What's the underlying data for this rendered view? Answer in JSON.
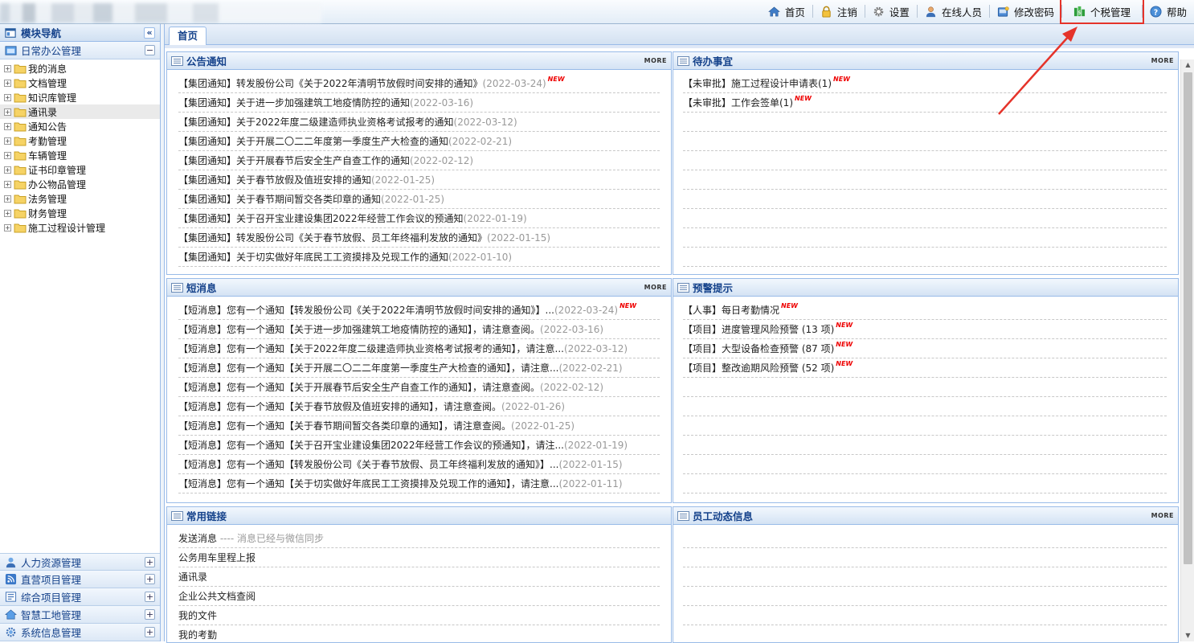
{
  "toolbar": {
    "items": [
      {
        "label": "首页",
        "icon": "home-icon"
      },
      {
        "label": "注销",
        "icon": "lock-icon"
      },
      {
        "label": "设置",
        "icon": "gear-icon"
      },
      {
        "label": "在线人员",
        "icon": "user-icon"
      },
      {
        "label": "修改密码",
        "icon": "password-icon"
      },
      {
        "label": "个税管理",
        "icon": "money-icon"
      },
      {
        "label": "帮助",
        "icon": "help-icon"
      }
    ],
    "highlight_color": "#e5332a"
  },
  "sidebar": {
    "title": "模块导航",
    "collapse_label": "«",
    "active_group": {
      "label": "日常办公管理",
      "toggle": "−"
    },
    "items": [
      {
        "label": "我的消息"
      },
      {
        "label": "文档管理"
      },
      {
        "label": "知识库管理"
      },
      {
        "label": "通讯录"
      },
      {
        "label": "通知公告"
      },
      {
        "label": "考勤管理"
      },
      {
        "label": "车辆管理"
      },
      {
        "label": "证书印章管理"
      },
      {
        "label": "办公物品管理"
      },
      {
        "label": "法务管理"
      },
      {
        "label": "财务管理"
      },
      {
        "label": "施工过程设计管理"
      }
    ],
    "bottom_groups": [
      {
        "label": "人力资源管理",
        "icon": "person-icon",
        "toggle": "+"
      },
      {
        "label": "直营项目管理",
        "icon": "rss-icon",
        "toggle": "+"
      },
      {
        "label": "综合项目管理",
        "icon": "form-icon",
        "toggle": "+"
      },
      {
        "label": "智慧工地管理",
        "icon": "house-icon",
        "toggle": "+"
      },
      {
        "label": "系统信息管理",
        "icon": "settings-icon",
        "toggle": "+"
      }
    ]
  },
  "tabs": {
    "home": "首页"
  },
  "more_label": "MORE",
  "new_badge": "NEW",
  "panels": {
    "notice": {
      "title": "公告通知",
      "rows": [
        {
          "text": "【集团通知】转发股份公司《关于2022年清明节放假时间安排的通知》",
          "date": "(2022-03-24)",
          "new": true
        },
        {
          "text": "【集团通知】关于进一步加强建筑工地疫情防控的通知",
          "date": "(2022-03-16)",
          "new": false
        },
        {
          "text": "【集团通知】关于2022年度二级建造师执业资格考试报考的通知",
          "date": "(2022-03-12)",
          "new": false
        },
        {
          "text": "【集团通知】关于开展二〇二二年度第一季度生产大检查的通知",
          "date": "(2022-02-21)",
          "new": false
        },
        {
          "text": "【集团通知】关于开展春节后安全生产自查工作的通知",
          "date": "(2022-02-12)",
          "new": false
        },
        {
          "text": "【集团通知】关于春节放假及值班安排的通知",
          "date": "(2022-01-25)",
          "new": false
        },
        {
          "text": "【集团通知】关于春节期间暂交各类印章的通知",
          "date": "(2022-01-25)",
          "new": false
        },
        {
          "text": "【集团通知】关于召开宝业建设集团2022年经营工作会议的预通知",
          "date": "(2022-01-19)",
          "new": false
        },
        {
          "text": "【集团通知】转发股份公司《关于春节放假、员工年终福利发放的通知》",
          "date": "(2022-01-15)",
          "new": false
        },
        {
          "text": "【集团通知】关于切实做好年底民工工资摸排及兑现工作的通知",
          "date": "(2022-01-10)",
          "new": false
        }
      ]
    },
    "todo": {
      "title": "待办事宜",
      "rows": [
        {
          "text": "【未审批】施工过程设计申请表(1)",
          "new": true
        },
        {
          "text": "【未审批】工作会签单(1)",
          "new": true
        }
      ]
    },
    "sms": {
      "title": "短消息",
      "rows": [
        {
          "text": "【短消息】您有一个通知【转发股份公司《关于2022年清明节放假时间安排的通知》】...",
          "date": "(2022-03-24)",
          "new": true
        },
        {
          "text": "【短消息】您有一个通知【关于进一步加强建筑工地疫情防控的通知】，请注意查阅。",
          "date": "(2022-03-16)",
          "new": false
        },
        {
          "text": "【短消息】您有一个通知【关于2022年度二级建造师执业资格考试报考的通知】，请注意...",
          "date": "(2022-03-12)",
          "new": false
        },
        {
          "text": "【短消息】您有一个通知【关于开展二〇二二年度第一季度生产大检查的通知】，请注意...",
          "date": "(2022-02-21)",
          "new": false
        },
        {
          "text": "【短消息】您有一个通知【关于开展春节后安全生产自查工作的通知】，请注意查阅。",
          "date": "(2022-02-12)",
          "new": false
        },
        {
          "text": "【短消息】您有一个通知【关于春节放假及值班安排的通知】，请注意查阅。",
          "date": "(2022-01-26)",
          "new": false
        },
        {
          "text": "【短消息】您有一个通知【关于春节期间暂交各类印章的通知】，请注意查阅。",
          "date": "(2022-01-25)",
          "new": false
        },
        {
          "text": "【短消息】您有一个通知【关于召开宝业建设集团2022年经营工作会议的预通知】，请注...",
          "date": "(2022-01-19)",
          "new": false
        },
        {
          "text": "【短消息】您有一个通知【转发股份公司《关于春节放假、员工年终福利发放的通知》】...",
          "date": "(2022-01-15)",
          "new": false
        },
        {
          "text": "【短消息】您有一个通知【关于切实做好年底民工工资摸排及兑现工作的通知】，请注意...",
          "date": "(2022-01-11)",
          "new": false
        }
      ]
    },
    "warning": {
      "title": "预警提示",
      "rows": [
        {
          "text": "【人事】每日考勤情况",
          "new": true
        },
        {
          "text": "【项目】进度管理风险预警 (13 项)",
          "new": true
        },
        {
          "text": "【项目】大型设备检查预警 (87 项)",
          "new": true
        },
        {
          "text": "【项目】整改逾期风险预警 (52 项)",
          "new": true
        }
      ]
    },
    "links": {
      "title": "常用链接",
      "rows": [
        {
          "text": "发送消息",
          "note": "---- 消息已经与微信同步"
        },
        {
          "text": "公务用车里程上报",
          "note": ""
        },
        {
          "text": "通讯录",
          "note": ""
        },
        {
          "text": "企业公共文档查阅",
          "note": ""
        },
        {
          "text": "我的文件",
          "note": ""
        },
        {
          "text": "我的考勤",
          "note": ""
        }
      ]
    },
    "staff": {
      "title": "员工动态信息",
      "rows": []
    }
  }
}
